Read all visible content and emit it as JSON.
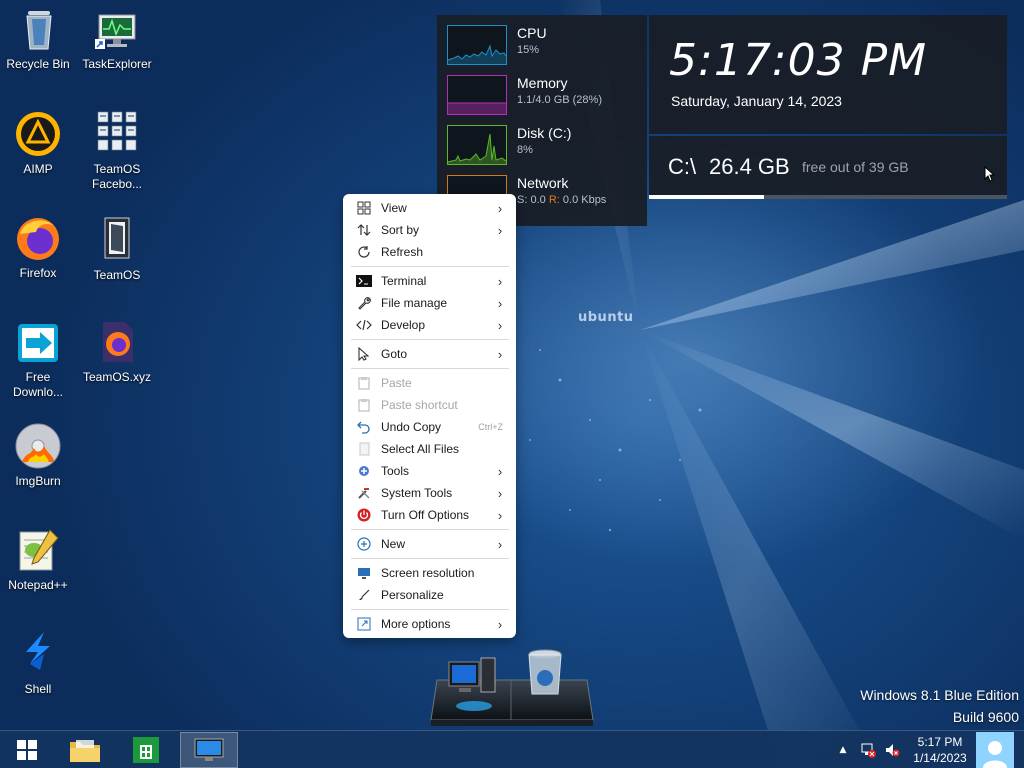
{
  "wallpaper": {
    "logo_text": "ubuntu",
    "edition_line1": "Windows 8.1 Blue Edition",
    "edition_line2": "Build 9600"
  },
  "desktop_icons": [
    {
      "label": "Recycle Bin",
      "icon": "recycle-bin-icon"
    },
    {
      "label": "TaskExplorer",
      "icon": "task-explorer-icon"
    },
    {
      "label": "AIMP",
      "icon": "aimp-icon"
    },
    {
      "label": "TeamOS Facebo...",
      "icon": "teamos-facebook-icon"
    },
    {
      "label": "Firefox",
      "icon": "firefox-icon"
    },
    {
      "label": "TeamOS",
      "icon": "teamos-icon"
    },
    {
      "label": "Free Downlo...",
      "icon": "free-download-manager-icon"
    },
    {
      "label": "TeamOS.xyz",
      "icon": "teamos-xyz-icon"
    },
    {
      "label": "ImgBurn",
      "icon": "imgburn-icon"
    },
    {
      "label": "Notepad++",
      "icon": "notepad-plus-plus-icon"
    },
    {
      "label": "Shell",
      "icon": "shell-icon"
    }
  ],
  "perf_widget": {
    "cpu": {
      "title": "CPU",
      "value": "15%",
      "color": "#1e90c8"
    },
    "memory": {
      "title": "Memory",
      "value": "1.1/4.0 GB (28%)",
      "color": "#b42fb4"
    },
    "disk": {
      "title": "Disk (C:)",
      "value": "8%",
      "color": "#5cb82a"
    },
    "network": {
      "title": "Network",
      "s_label": "S:",
      "s_value": "0.0",
      "r_label": "R:",
      "r_value": "0.0 Kbps",
      "color": "#d07a1a"
    }
  },
  "clock_widget": {
    "time": "5:17:03 PM",
    "date": "Saturday, January 14, 2023"
  },
  "disk_widget": {
    "drive": "C:\\",
    "free": "26.4 GB",
    "suffix": "free out of 39 GB",
    "used_fraction": 0.32
  },
  "context_menu": {
    "items": [
      {
        "label": "View",
        "icon": "grid-icon",
        "submenu": true
      },
      {
        "label": "Sort by",
        "icon": "sort-icon",
        "submenu": true
      },
      {
        "label": "Refresh",
        "icon": "refresh-icon",
        "submenu": false
      },
      {
        "label": "Terminal",
        "icon": "terminal-icon",
        "submenu": true
      },
      {
        "label": "File manage",
        "icon": "wrench-icon",
        "submenu": true
      },
      {
        "label": "Develop",
        "icon": "code-icon",
        "submenu": true
      },
      {
        "label": "Goto",
        "icon": "cursor-icon",
        "submenu": true
      },
      {
        "label": "Paste",
        "icon": "paste-icon",
        "submenu": false,
        "disabled": true
      },
      {
        "label": "Paste shortcut",
        "icon": "paste-shortcut-icon",
        "submenu": false,
        "disabled": true
      },
      {
        "label": "Undo Copy",
        "icon": "undo-icon",
        "submenu": false,
        "shortcut": "Ctrl+Z"
      },
      {
        "label": "Select All Files",
        "icon": "select-all-icon",
        "submenu": false
      },
      {
        "label": "Tools",
        "icon": "tools-icon",
        "submenu": true
      },
      {
        "label": "System Tools",
        "icon": "system-tools-icon",
        "submenu": true
      },
      {
        "label": "Turn Off Options",
        "icon": "power-icon",
        "submenu": true
      },
      {
        "label": "New",
        "icon": "plus-circle-icon",
        "submenu": true
      },
      {
        "label": "Screen resolution",
        "icon": "monitor-icon",
        "submenu": false
      },
      {
        "label": "Personalize",
        "icon": "brush-icon",
        "submenu": false
      },
      {
        "label": "More options",
        "icon": "more-options-icon",
        "submenu": true
      }
    ]
  },
  "taskbar": {
    "time": "5:17 PM",
    "date": "1/14/2023",
    "show_hidden_icon": "▲"
  }
}
